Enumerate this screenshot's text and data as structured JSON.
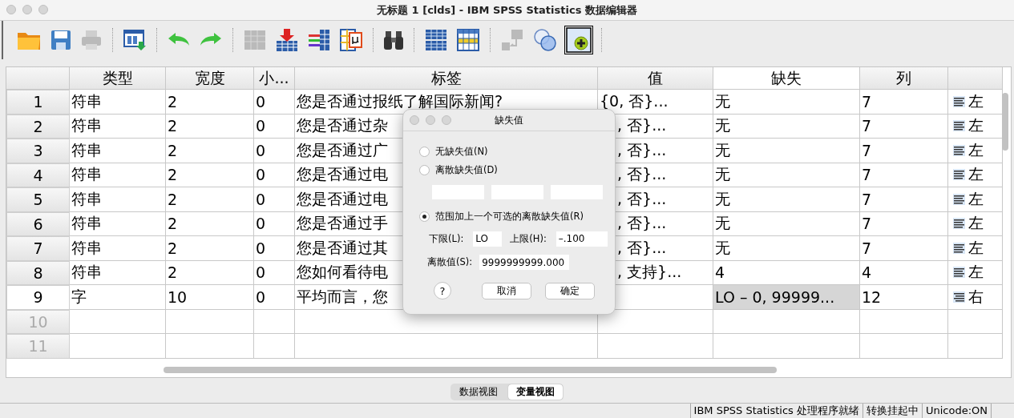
{
  "window": {
    "title": "无标题 1 [clds] - IBM SPSS Statistics 数据编辑器"
  },
  "toolbar": [
    {
      "kind": "folder",
      "disabled": false,
      "on": false
    },
    {
      "kind": "save",
      "disabled": false,
      "on": false
    },
    {
      "kind": "printer",
      "disabled": true,
      "on": false
    },
    {
      "kind": "sep"
    },
    {
      "kind": "recall",
      "disabled": false,
      "on": false
    },
    {
      "kind": "sep"
    },
    {
      "kind": "undo",
      "disabled": false,
      "on": false
    },
    {
      "kind": "redo",
      "disabled": false,
      "on": false
    },
    {
      "kind": "sep"
    },
    {
      "kind": "goto",
      "disabled": true,
      "on": false
    },
    {
      "kind": "insert",
      "disabled": false,
      "on": false
    },
    {
      "kind": "variables",
      "disabled": false,
      "on": false
    },
    {
      "kind": "mu",
      "disabled": false,
      "on": false
    },
    {
      "kind": "sep"
    },
    {
      "kind": "find",
      "disabled": false,
      "on": false
    },
    {
      "kind": "sep"
    },
    {
      "kind": "split",
      "disabled": false,
      "on": false
    },
    {
      "kind": "weight",
      "disabled": false,
      "on": false
    },
    {
      "kind": "sep"
    },
    {
      "kind": "labels",
      "disabled": true,
      "on": false
    },
    {
      "kind": "sets",
      "disabled": false,
      "on": false
    },
    {
      "kind": "add",
      "disabled": false,
      "on": true
    },
    {
      "kind": "sep"
    }
  ],
  "table": {
    "columns": [
      {
        "label": "类型",
        "selected": false
      },
      {
        "label": "宽度",
        "selected": false
      },
      {
        "label": "小...",
        "selected": false
      },
      {
        "label": "标签",
        "selected": false
      },
      {
        "label": "值",
        "selected": false
      },
      {
        "label": "缺失",
        "selected": true
      },
      {
        "label": "列",
        "selected": false
      }
    ],
    "rows": [
      {
        "num": "1",
        "selected": false,
        "disabled": false,
        "right_aligned": false,
        "cells": [
          "符串",
          "2",
          "0",
          "您是否通过报纸了解国际新闻?",
          "{0, 否}...",
          "无",
          "7",
          "左"
        ]
      },
      {
        "num": "2",
        "selected": false,
        "disabled": false,
        "right_aligned": false,
        "cells": [
          "符串",
          "2",
          "0",
          "您是否通过杂",
          ", 否}...",
          "无",
          "7",
          "左"
        ]
      },
      {
        "num": "3",
        "selected": false,
        "disabled": false,
        "right_aligned": false,
        "cells": [
          "符串",
          "2",
          "0",
          "您是否通过广",
          ", 否}...",
          "无",
          "7",
          "左"
        ]
      },
      {
        "num": "4",
        "selected": false,
        "disabled": false,
        "right_aligned": false,
        "cells": [
          "符串",
          "2",
          "0",
          "您是否通过电",
          ", 否}...",
          "无",
          "7",
          "左"
        ]
      },
      {
        "num": "5",
        "selected": false,
        "disabled": false,
        "right_aligned": false,
        "cells": [
          "符串",
          "2",
          "0",
          "您是否通过电",
          ", 否}...",
          "无",
          "7",
          "左"
        ]
      },
      {
        "num": "6",
        "selected": false,
        "disabled": false,
        "right_aligned": false,
        "cells": [
          "符串",
          "2",
          "0",
          "您是否通过手",
          ", 否}...",
          "无",
          "7",
          "左"
        ]
      },
      {
        "num": "7",
        "selected": false,
        "disabled": false,
        "right_aligned": false,
        "cells": [
          "符串",
          "2",
          "0",
          "您是否通过其",
          ", 否}...",
          "无",
          "7",
          "左"
        ]
      },
      {
        "num": "8",
        "selected": false,
        "disabled": false,
        "right_aligned": false,
        "cells": [
          "符串",
          "2",
          "0",
          "您如何看待电",
          ", 支持}...",
          "4",
          "4",
          "左"
        ]
      },
      {
        "num": "9",
        "selected": true,
        "disabled": false,
        "right_aligned": true,
        "cells": [
          "字",
          "10",
          "0",
          "平均而言，您",
          "",
          "LO – 0, 99999...",
          "12",
          "右"
        ]
      },
      {
        "num": "10",
        "selected": false,
        "disabled": true
      },
      {
        "num": "11",
        "selected": false,
        "disabled": true
      }
    ]
  },
  "view_tabs": [
    {
      "label": "数据视图",
      "selected": false
    },
    {
      "label": "变量视图",
      "selected": true
    }
  ],
  "status_bar": [
    "IBM SPSS Statistics 处理程序就绪",
    "转换挂起中",
    "Unicode:ON"
  ],
  "dialog": {
    "title": "缺失值",
    "options": [
      {
        "label": "无缺失值(N)",
        "selected": false
      },
      {
        "label": "离散缺失值(D)",
        "selected": false
      },
      {
        "label": "范围加上一个可选的离散缺失值(R)",
        "selected": true
      }
    ],
    "low": {
      "label": "下限(L):",
      "value": "LO"
    },
    "high": {
      "label": "上限(H):",
      "value": "–.100"
    },
    "discrete": {
      "label": "离散值(S):",
      "value": "9999999999.000"
    },
    "help": "?",
    "buttons": [
      "取消",
      "确定"
    ]
  }
}
